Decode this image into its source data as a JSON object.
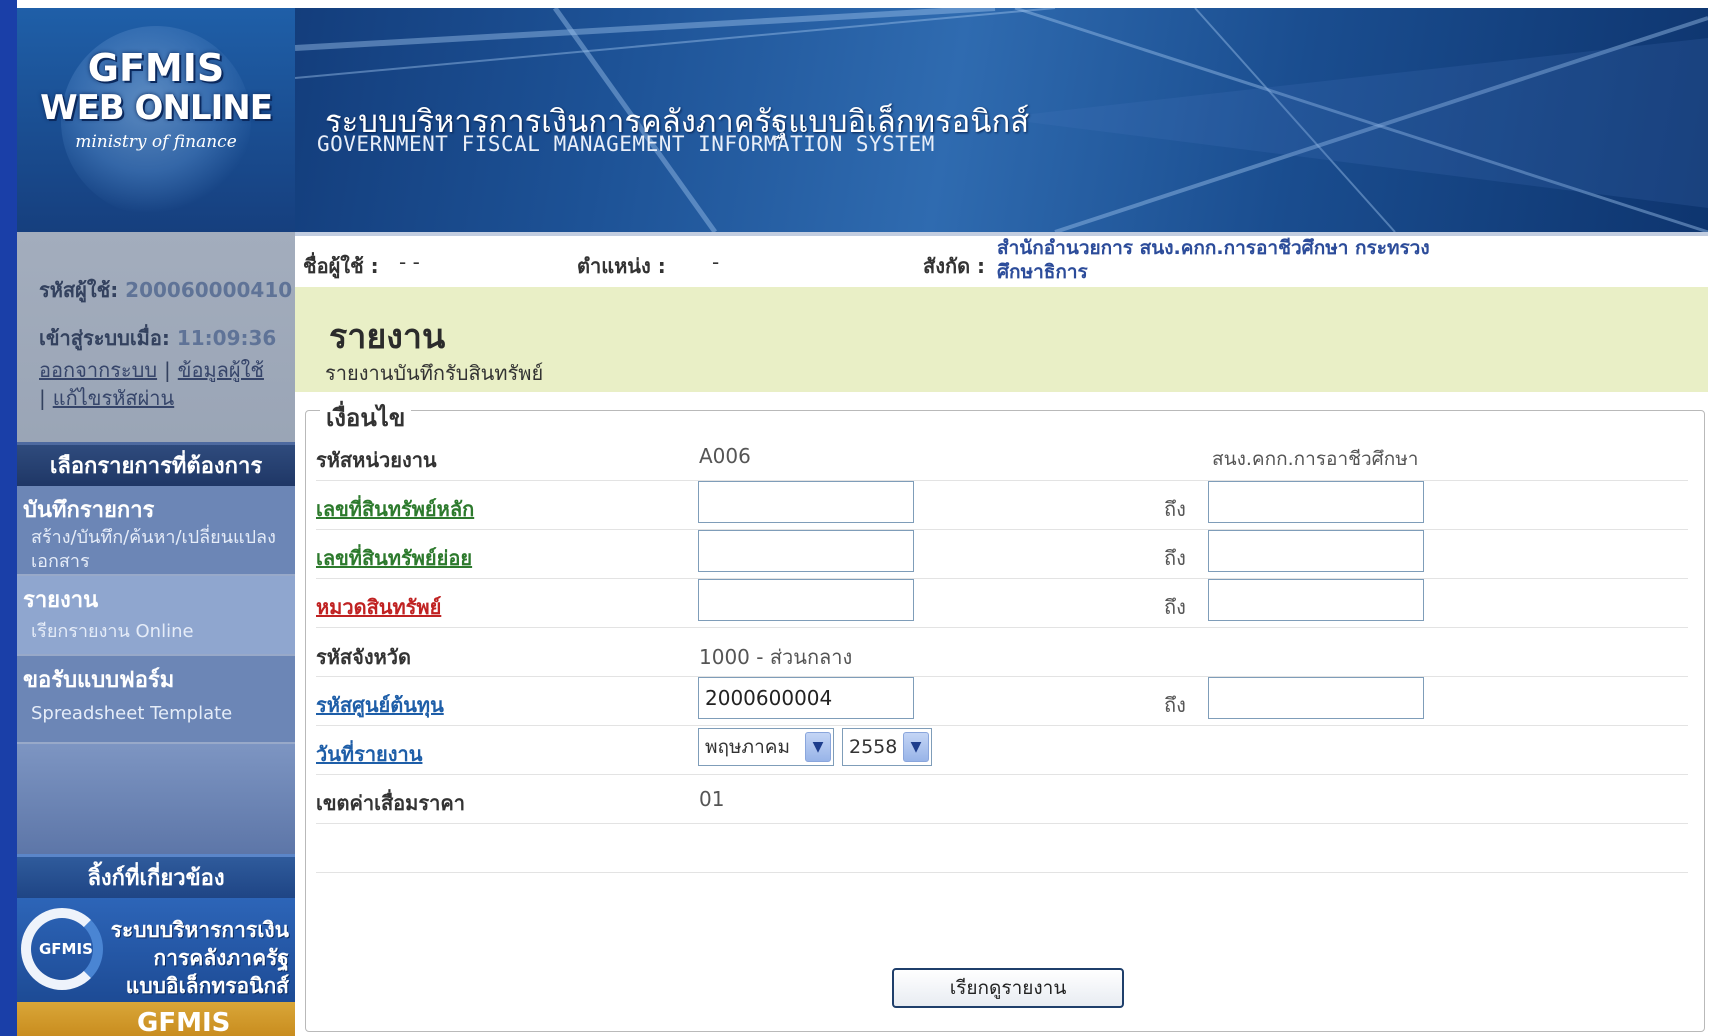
{
  "header": {
    "logo_line1": "GFMIS",
    "logo_line2": "WEB ONLINE",
    "logo_line3": "ministry of finance",
    "title_th": "ระบบบริหารการเงินการคลังภาครัฐแบบอิเล็กทรอนิกส์",
    "title_en": "GOVERNMENT FISCAL MANAGEMENT INFORMATION SYSTEM"
  },
  "user": {
    "id_label": "รหัสผู้ใช้:",
    "id_value": "200060000410",
    "login_label": "เข้าสู่ระบบเมื่อ:",
    "login_time": "11:09:36",
    "logout": "ออกจากระบบ",
    "user_info": "ข้อมูลผู้ใช้",
    "change_password": "แก้ไขรหัสผ่าน",
    "sep": "|"
  },
  "menu": {
    "title": "เลือกรายการที่ต้องการ",
    "items": [
      {
        "head": "บันทึกรายการ",
        "sub": "สร้าง/บันทึก/ค้นหา/เปลี่ยนแปลง เอกสาร"
      },
      {
        "head": "รายงาน",
        "sub": "เรียกรายงาน Online"
      },
      {
        "head": "ขอรับแบบฟอร์ม",
        "sub": "Spreadsheet Template"
      }
    ]
  },
  "links": {
    "title": "ลิ้งก์ที่เกี่ยวข้อง",
    "banner1_ring": "GFMIS",
    "banner1_l1": "ระบบบริหารการเงิน",
    "banner1_l2": "การคลังภาครัฐ",
    "banner1_l3": "แบบอิเล็กทรอนิกส์",
    "banner2": "GFMIS"
  },
  "infobar": {
    "username_label": "ชื่อผู้ใช้ :",
    "username_value": "- -",
    "position_label": "ตำแหน่ง :",
    "position_value": "-",
    "dept_label": "สังกัด :",
    "dept_value": "สำนักอำนวยการ สนง.คกก.การอาชีวศึกษา กระทรวงศึกษาธิการ"
  },
  "page": {
    "title": "รายงาน",
    "subtitle": "รายงานบันทึกรับสินทรัพย์"
  },
  "form": {
    "legend": "เงื่อนไข",
    "to_label": "ถึง",
    "unit_code_label": "รหัสหน่วยงาน",
    "unit_code_value": "A006",
    "unit_name": "สนง.คกก.การอาชีวศึกษา",
    "main_asset_label": "เลขที่สินทรัพย์หลัก",
    "main_asset_from": "",
    "main_asset_to": "",
    "sub_asset_label": "เลขที่สินทรัพย์ย่อย",
    "sub_asset_from": "",
    "sub_asset_to": "",
    "asset_class_label": "หมวดสินทรัพย์",
    "asset_class_from": "",
    "asset_class_to": "",
    "province_label": "รหัสจังหวัด",
    "province_value": "1000 - ส่วนกลาง",
    "cost_center_label": "รหัสศูนย์ต้นทุน",
    "cost_center_from": "2000600004",
    "cost_center_to": "",
    "report_date_label": "วันที่รายงาน",
    "month": "พฤษภาคม",
    "year": "2558",
    "depr_area_label": "เขตค่าเสื่อมราคา",
    "depr_area_value": "01",
    "submit": "เรียกดูรายงาน"
  },
  "colors": {
    "header_blue": "#1d5296",
    "title_band": "#e9efc6",
    "menu_blue": "#6c86b6",
    "link_blue": "#1e5ea8",
    "link_green": "#2d7a2d",
    "link_red": "#c02222"
  }
}
